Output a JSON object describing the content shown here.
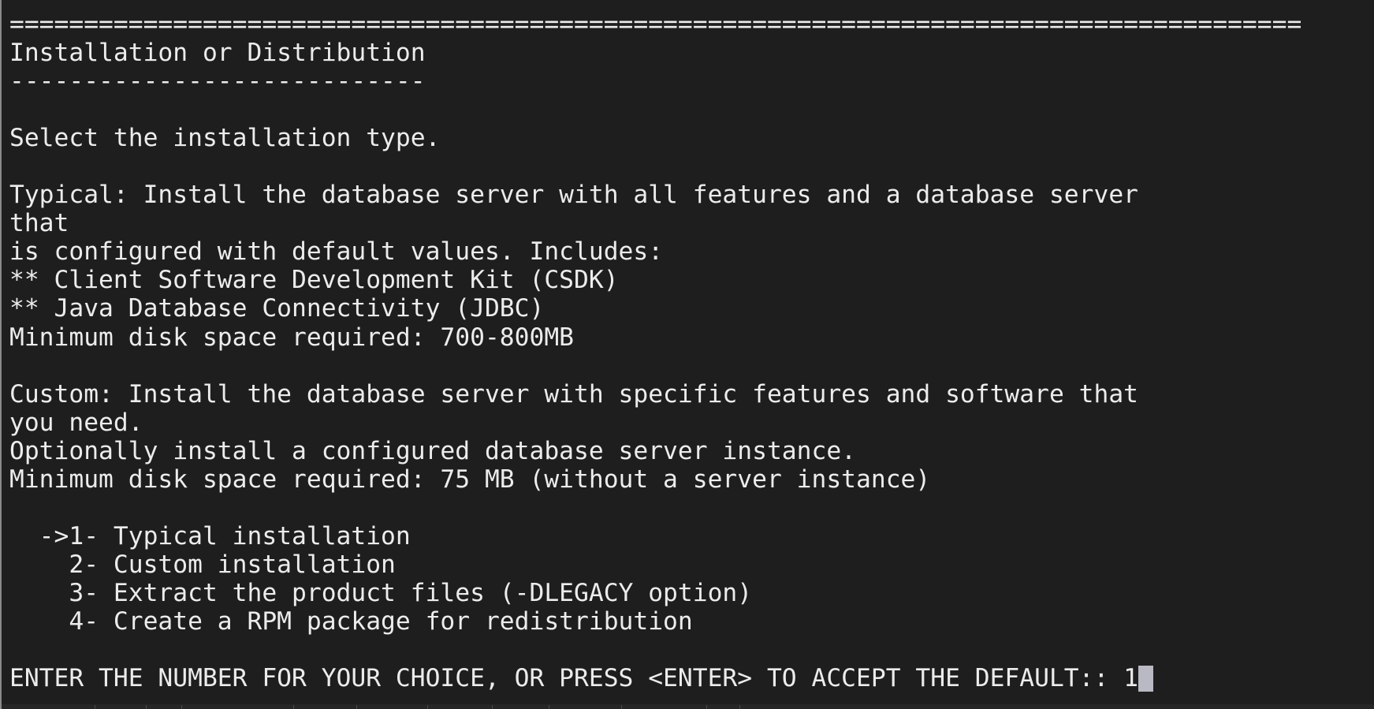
{
  "terminal": {
    "separator": "=======================================================================================",
    "title": "Installation or Distribution",
    "title_underline": "----------------------------",
    "prompt_select": "Select the installation type.",
    "typical_line1": "Typical: Install the database server with all features and a database server",
    "typical_line2": "that",
    "typical_line3": "is configured with default values. Includes:",
    "typical_item1": "** Client Software Development Kit (CSDK)",
    "typical_item2": "** Java Database Connectivity (JDBC)",
    "typical_disk": "Minimum disk space required: 700-800MB",
    "custom_line1": "Custom: Install the database server with specific features and software that",
    "custom_line2": "you need.",
    "custom_line3": "Optionally install a configured database server instance.",
    "custom_disk": "Minimum disk space required: 75 MB (without a server instance)",
    "options": [
      "  ->1- Typical installation",
      "    2- Custom installation",
      "    3- Extract the product files (-DLEGACY option)",
      "    4- Create a RPM package for redistribution"
    ],
    "input_prompt": "ENTER THE NUMBER FOR YOUR CHOICE, OR PRESS <ENTER> TO ACCEPT THE DEFAULT:: ",
    "input_value": "1"
  },
  "colors": {
    "background": "#1e1e1e",
    "foreground": "#ececec",
    "cursor": "#b9b9c4"
  }
}
